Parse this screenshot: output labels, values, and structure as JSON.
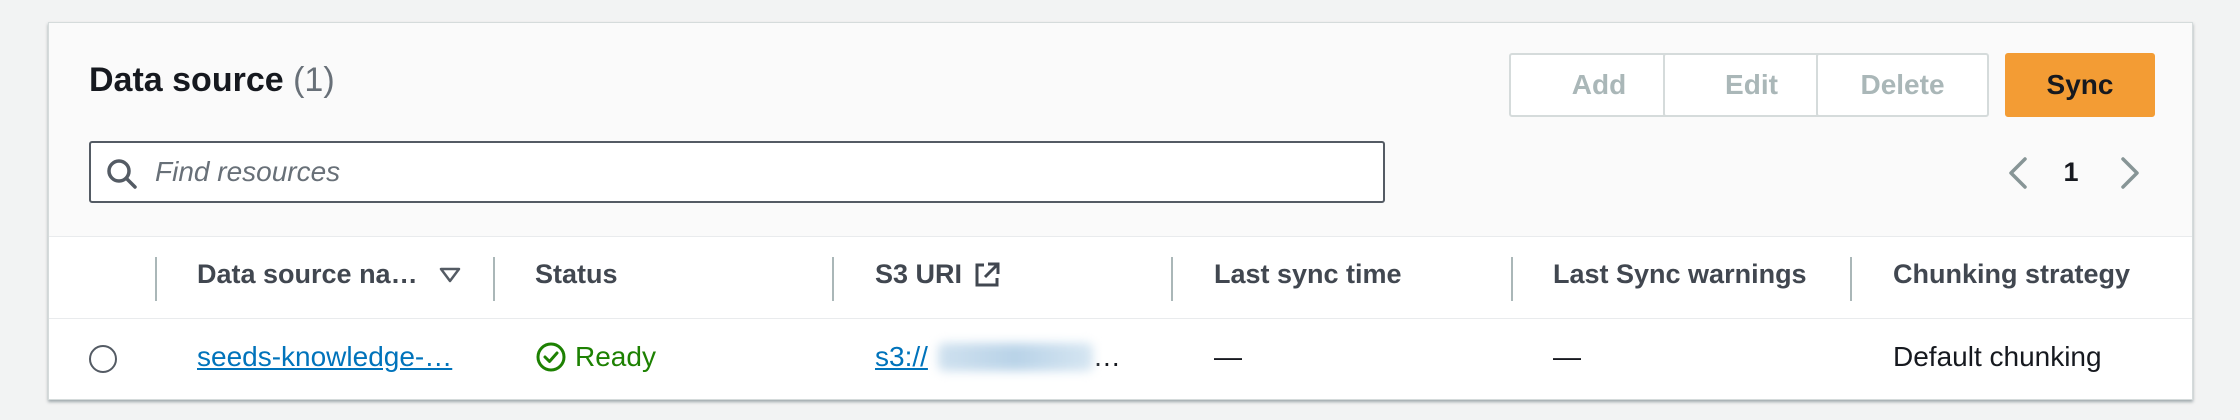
{
  "header": {
    "title": "Data source",
    "count": "(1)"
  },
  "actions": {
    "add": "Add",
    "edit": "Edit",
    "delete": "Delete",
    "sync": "Sync"
  },
  "search": {
    "placeholder": "Find resources"
  },
  "pagination": {
    "current_page": "1"
  },
  "table": {
    "columns": [
      "Data source na…",
      "Status",
      "S3 URI",
      "Last sync time",
      "Last Sync warnings",
      "Chunking strategy"
    ],
    "rows": [
      {
        "name": "seeds-knowledge-…",
        "status": "Ready",
        "s3_uri": "s3://",
        "s3_uri_suffix": "…",
        "last_sync_time": "—",
        "last_sync_warnings": "—",
        "chunking_strategy": "Default chunking"
      }
    ]
  },
  "colors": {
    "accent": "#f39c34",
    "link": "#0073bb",
    "success": "#1d8102"
  },
  "icons": [
    "search-icon",
    "chevron-left-icon",
    "chevron-right-icon",
    "sort-descending-icon",
    "external-link-icon",
    "status-ready-icon"
  ]
}
